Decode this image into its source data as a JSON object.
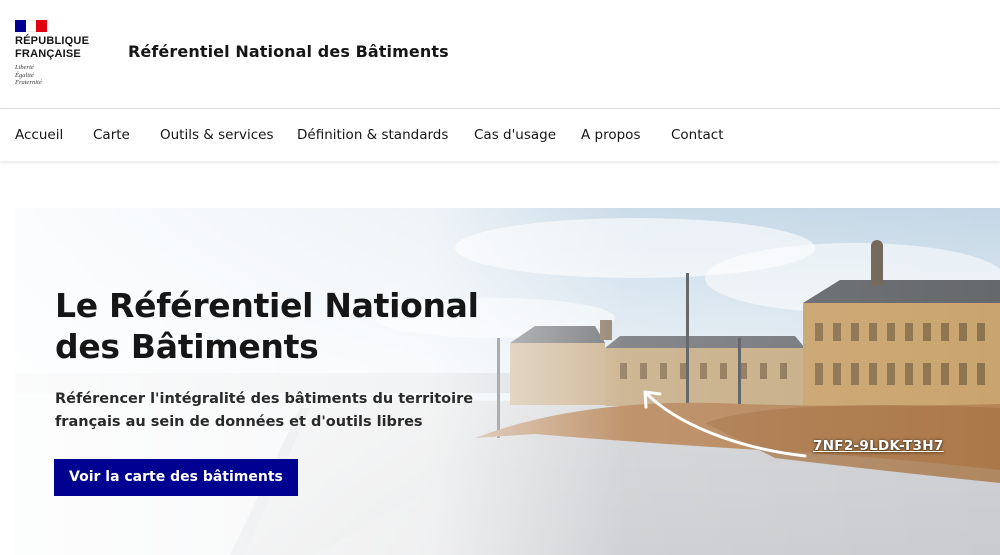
{
  "header": {
    "logo": {
      "line1": "RÉPUBLIQUE",
      "line2": "FRANÇAISE",
      "motto": [
        "Liberté",
        "Égalité",
        "Fraternité"
      ],
      "flag_colors": [
        "#000091",
        "#ffffff",
        "#e1000f"
      ]
    },
    "site_title": "Référentiel National des Bâtiments"
  },
  "nav": {
    "items": [
      {
        "label": "Accueil"
      },
      {
        "label": "Carte"
      },
      {
        "label": "Outils & services"
      },
      {
        "label": "Définition & standards"
      },
      {
        "label": "Cas d'usage"
      },
      {
        "label": "A propos"
      },
      {
        "label": "Contact"
      }
    ]
  },
  "hero": {
    "title_line1": "Le Référentiel National",
    "title_line2": "des Bâtiments",
    "subtitle_line1": "Référencer l'intégralité des bâtiments du territoire",
    "subtitle_line2": "français au sein de données et d'outils libres",
    "cta_label": "Voir la carte des bâtiments",
    "building_id": "7NF2-9LDK-T3H7",
    "arrow_icon": "curved-arrow-icon"
  },
  "colors": {
    "accent": "#000091",
    "text": "#161616",
    "border": "#dddddd"
  }
}
